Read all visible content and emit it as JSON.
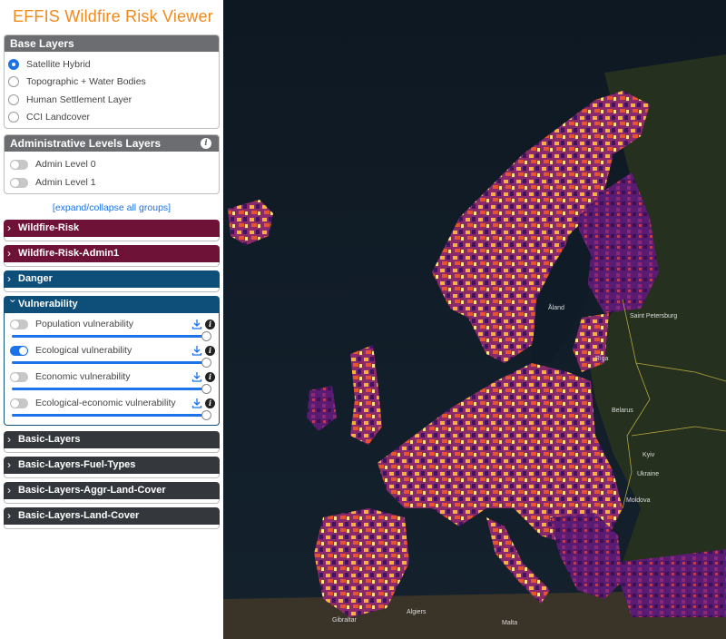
{
  "app": {
    "title": "EFFIS Wildfire Risk Viewer"
  },
  "base_layers": {
    "title": "Base Layers",
    "options": [
      {
        "label": "Satellite Hybrid",
        "selected": true
      },
      {
        "label": "Topographic + Water Bodies",
        "selected": false
      },
      {
        "label": "Human Settlement Layer",
        "selected": false
      },
      {
        "label": "CCI Landcover",
        "selected": false
      }
    ]
  },
  "admin_layers": {
    "title": "Administrative Levels Layers",
    "info_icon": "info-icon",
    "items": [
      {
        "label": "Admin Level 0",
        "on": false
      },
      {
        "label": "Admin Level 1",
        "on": false
      }
    ]
  },
  "expand_link": "[expand/collapse all groups]",
  "groups": {
    "wildfire_risk": "Wildfire-Risk",
    "wildfire_risk_admin1": "Wildfire-Risk-Admin1",
    "danger": "Danger",
    "vulnerability": "Vulnerability",
    "basic_layers": "Basic-Layers",
    "basic_fuel": "Basic-Layers-Fuel-Types",
    "basic_aggr": "Basic-Layers-Aggr-Land-Cover",
    "basic_land": "Basic-Layers-Land-Cover"
  },
  "vulnerability_layers": [
    {
      "label": "Population vulnerability",
      "on": false,
      "opacity": 1.0
    },
    {
      "label": "Ecological vulnerability",
      "on": true,
      "opacity": 1.0
    },
    {
      "label": "Economic vulnerability",
      "on": false,
      "opacity": 1.0
    },
    {
      "label": "Ecological-economic vulnerability",
      "on": false,
      "opacity": 1.0
    }
  ],
  "map_labels": {
    "aland": "Åland",
    "riga": "Riga",
    "st_petersburg": "Saint Petersburg",
    "belarus": "Belarus",
    "kyiv": "Kyiv",
    "ukraine": "Ukraine",
    "moldova": "Moldova",
    "algiers": "Algiers",
    "malta": "Malta",
    "gibraltar": "Gibraltar"
  },
  "colors": {
    "title": "#f28a1e",
    "panel_header": "#6b6d70",
    "risk_group": "#6f1238",
    "danger_group": "#0d4f78",
    "basic_group": "#34383c",
    "accent": "#1a73e8"
  }
}
